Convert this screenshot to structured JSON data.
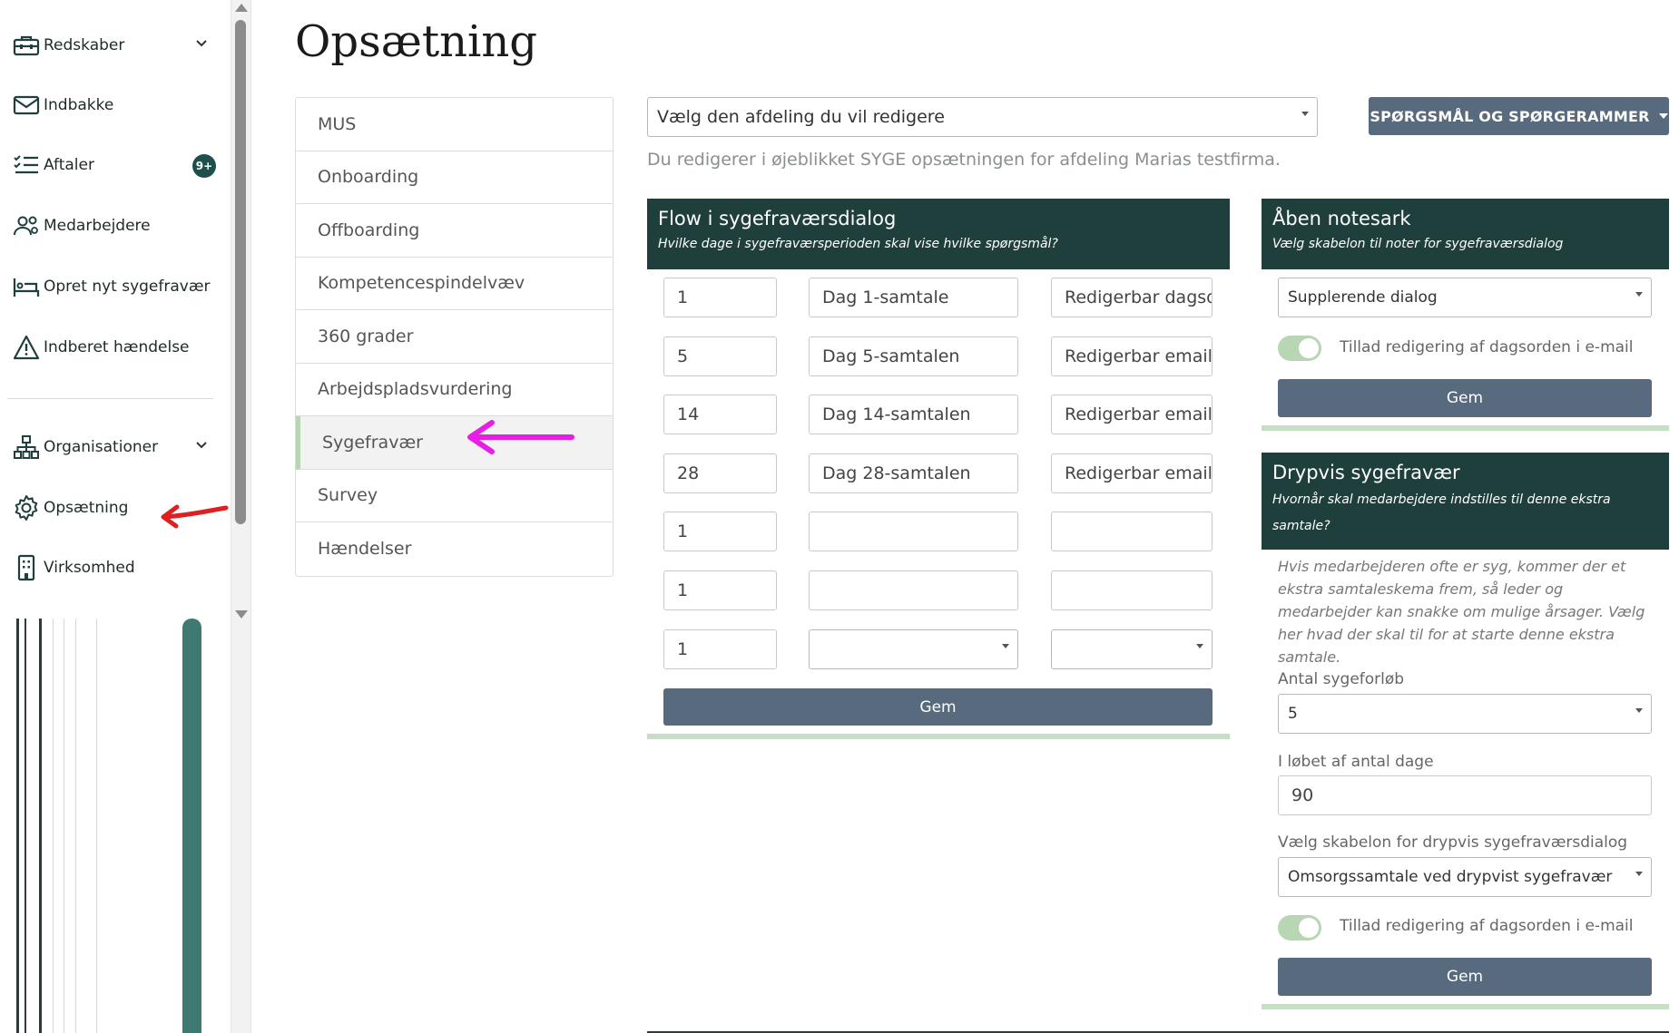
{
  "sidebar": {
    "items": [
      {
        "label": "Redskaber",
        "icon": "toolbox-icon"
      },
      {
        "label": "Indbakke",
        "icon": "mail-icon"
      },
      {
        "label": "Aftaler",
        "icon": "list-icon",
        "badge": "9+"
      },
      {
        "label": "Medarbejdere",
        "icon": "users-icon"
      },
      {
        "label": "Opret nyt sygefravær",
        "icon": "bed-icon"
      },
      {
        "label": "Indberet hændelse",
        "icon": "warning-icon"
      },
      {
        "label": "Organisationer",
        "icon": "org-icon"
      },
      {
        "label": "Opsætning",
        "icon": "gear-icon"
      },
      {
        "label": "Virksomhed",
        "icon": "building-icon"
      }
    ]
  },
  "page": {
    "title": "Opsætning"
  },
  "categories": [
    "MUS",
    "Onboarding",
    "Offboarding",
    "Kompetencespindelvæv",
    "360 grader",
    "Arbejdspladsvurdering",
    "Sygefravær",
    "Survey",
    "Hændelser"
  ],
  "dept": {
    "select_label": "Vælg den afdeling du vil redigere",
    "info": "Du redigerer i øjeblikket SYGE opsætningen for afdeling Marias testfirma."
  },
  "questions_button": "SPØRGSMÅL OG SPØRGERAMMER",
  "flow": {
    "title": "Flow i sygefraværsdialog",
    "subtitle": "Hvilke dage i sygefraværsperioden skal vise hvilke spørgsmål?",
    "rows": [
      {
        "day": "1",
        "name": "Dag 1-samtale",
        "template": "Redigerbar dagsorden"
      },
      {
        "day": "5",
        "name": "Dag 5-samtalen",
        "template": "Redigerbar email"
      },
      {
        "day": "14",
        "name": "Dag 14-samtalen",
        "template": "Redigerbar email"
      },
      {
        "day": "28",
        "name": "Dag 28-samtalen",
        "template": "Redigerbar email"
      },
      {
        "day": "1",
        "name": "",
        "template": ""
      },
      {
        "day": "1",
        "name": "",
        "template": ""
      },
      {
        "day": "1",
        "name": "",
        "template": ""
      }
    ],
    "save": "Gem"
  },
  "notes": {
    "title": "Åben notesark",
    "subtitle": "Vælg skabelon til noter for sygefraværsdialog",
    "template_value": "Supplerende dialog",
    "toggle_label": "Tillad redigering af dagsorden i e-mail",
    "save": "Gem"
  },
  "drip": {
    "title": "Drypvis sygefravær",
    "subtitle": "Hvornår skal medarbejdere indstilles til denne ekstra samtale?",
    "help": "Hvis medarbejderen ofte er syg, kommer der et ekstra samtaleskema frem, så leder og medarbejder kan snakke om mulige årsager. Vælg her hvad der skal til for at starte denne ekstra samtale.",
    "count_label": "Antal sygeforløb",
    "count_value": "5",
    "days_label": "I løbet af antal dage",
    "days_value": "90",
    "template_label": "Vælg skabelon for drypvis sygefraværsdialog",
    "template_value": "Omsorgssamtale ved drypvist sygefravær",
    "toggle_label": "Tillad redigering af dagsorden i e-mail",
    "save": "Gem"
  },
  "colors": {
    "header": "#1f3f3d",
    "button": "#586a7d",
    "accent": "#b8d6b4",
    "badge": "#1f4f4a"
  }
}
